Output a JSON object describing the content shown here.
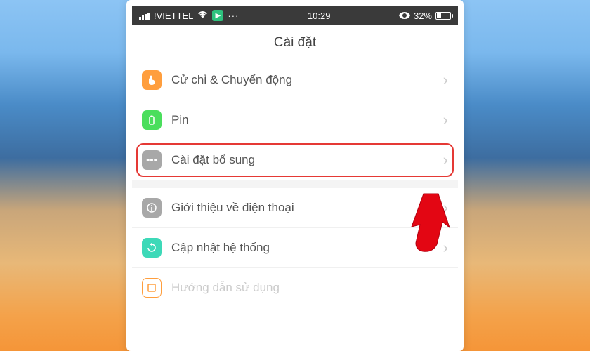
{
  "status": {
    "carrier": "!VIETTEL",
    "time": "10:29",
    "battery_pct": "32%"
  },
  "header": {
    "title": "Cài đặt"
  },
  "rows": {
    "gesture": {
      "label": "Cử chỉ & Chuyển động"
    },
    "battery": {
      "label": "Pin"
    },
    "additional": {
      "label": "Cài đặt bổ sung"
    },
    "about": {
      "label": "Giới thiệu về điện thoại"
    },
    "update": {
      "label": "Cập nhật hệ thống"
    },
    "manual": {
      "label": "Hướng dẫn sử dụng"
    }
  }
}
